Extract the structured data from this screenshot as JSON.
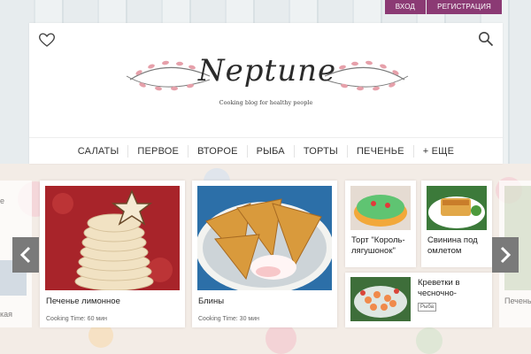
{
  "auth": {
    "login": "ВХОД",
    "register": "РЕГИСТРАЦИЯ"
  },
  "header": {
    "title": "Neptune",
    "subtitle": "Cooking blog for healthy people",
    "favorites_icon": "heart-icon",
    "search_icon": "search-icon"
  },
  "nav": [
    "САЛАТЫ",
    "ПЕРВОЕ",
    "ВТОРОЕ",
    "РЫБА",
    "ТОРТЫ",
    "ПЕЧЕНЬЕ",
    "+ ЕЩЕ"
  ],
  "slider": {
    "prev_icon": "chevron-left-icon",
    "next_icon": "chevron-right-icon",
    "left_partial": {
      "title_fragment": "кая",
      "top_fragment": "е"
    },
    "right_partial": {
      "title_fragment": "Печень"
    },
    "cards": [
      {
        "title": "Печенье лимонное",
        "meta": "Cooking Time: 60 мин"
      },
      {
        "title": "Блины",
        "meta": "Cooking Time: 30 мин"
      },
      {
        "title": "Торт \"Король-лягушонок\""
      },
      {
        "title": "Свинина под омлетом"
      },
      {
        "title": "Креветки в чесночно-",
        "tag": "Рыба"
      }
    ]
  },
  "colors": {
    "accent": "#8b3a74",
    "arrow": "#7a7a7a",
    "text": "#222222"
  }
}
